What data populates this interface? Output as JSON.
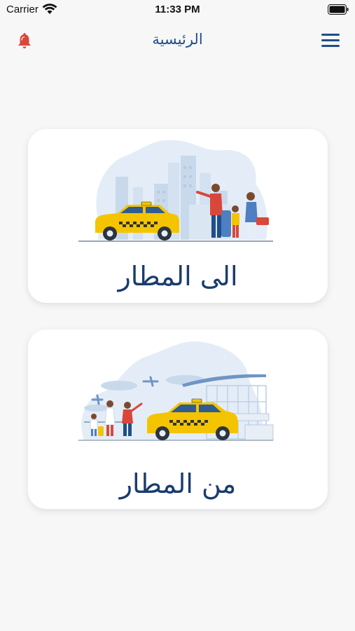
{
  "status_bar": {
    "carrier": "Carrier",
    "time": "11:33 PM"
  },
  "nav": {
    "title": "الرئيسية",
    "left_icon": "bell-icon",
    "right_icon": "hamburger-menu-icon"
  },
  "cards": [
    {
      "label": "الى المطار",
      "illustration": "taxi-to-airport-illustration"
    },
    {
      "label": "من المطار",
      "illustration": "taxi-from-airport-illustration"
    }
  ],
  "colors": {
    "accent": "#1f4e8c",
    "card_text": "#1a3c6e",
    "bell": "#d9473b",
    "taxi": "#f5c400",
    "background": "#f7f7f7"
  }
}
